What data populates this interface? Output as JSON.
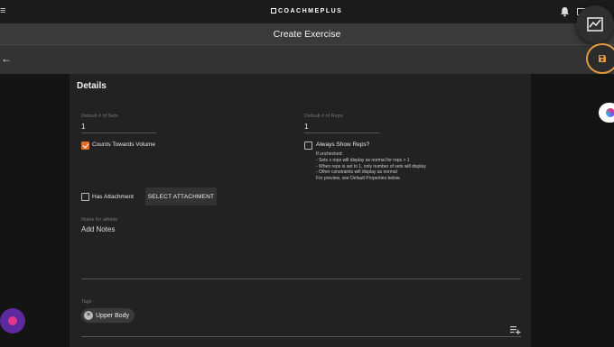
{
  "header": {
    "brand": "COACHMEPLUS",
    "hamburger": "≡"
  },
  "titlebar": {
    "title": "Create Exercise"
  },
  "actionbar": {
    "back": "←"
  },
  "details": {
    "heading": "Details",
    "sets": {
      "label": "Default # of Sets",
      "value": "1"
    },
    "reps": {
      "label": "Default # of Reps",
      "value": "1"
    },
    "counts_volume": {
      "label": "Counts Towards Volume",
      "checked": true
    },
    "always_show_reps": {
      "label": "Always Show Reps?",
      "checked": false,
      "hint": [
        "If unchecked:",
        "- Sets x reps will display as normal for reps > 1",
        "- When reps is set to 1, only number of sets will display",
        "- Other constraints will display as normal",
        "For preview, see Default Properties below."
      ]
    },
    "attachment": {
      "label": "Has Attachment",
      "checked": false,
      "button": "SELECT ATTACHMENT"
    },
    "notes": {
      "label": "Notes for athlete",
      "placeholder": "Add Notes"
    },
    "tags": {
      "label": "Tags",
      "chips": [
        "Upper Body"
      ]
    }
  },
  "colors": {
    "accent": "#e06a2a",
    "save_ring": "#e39a3e"
  }
}
